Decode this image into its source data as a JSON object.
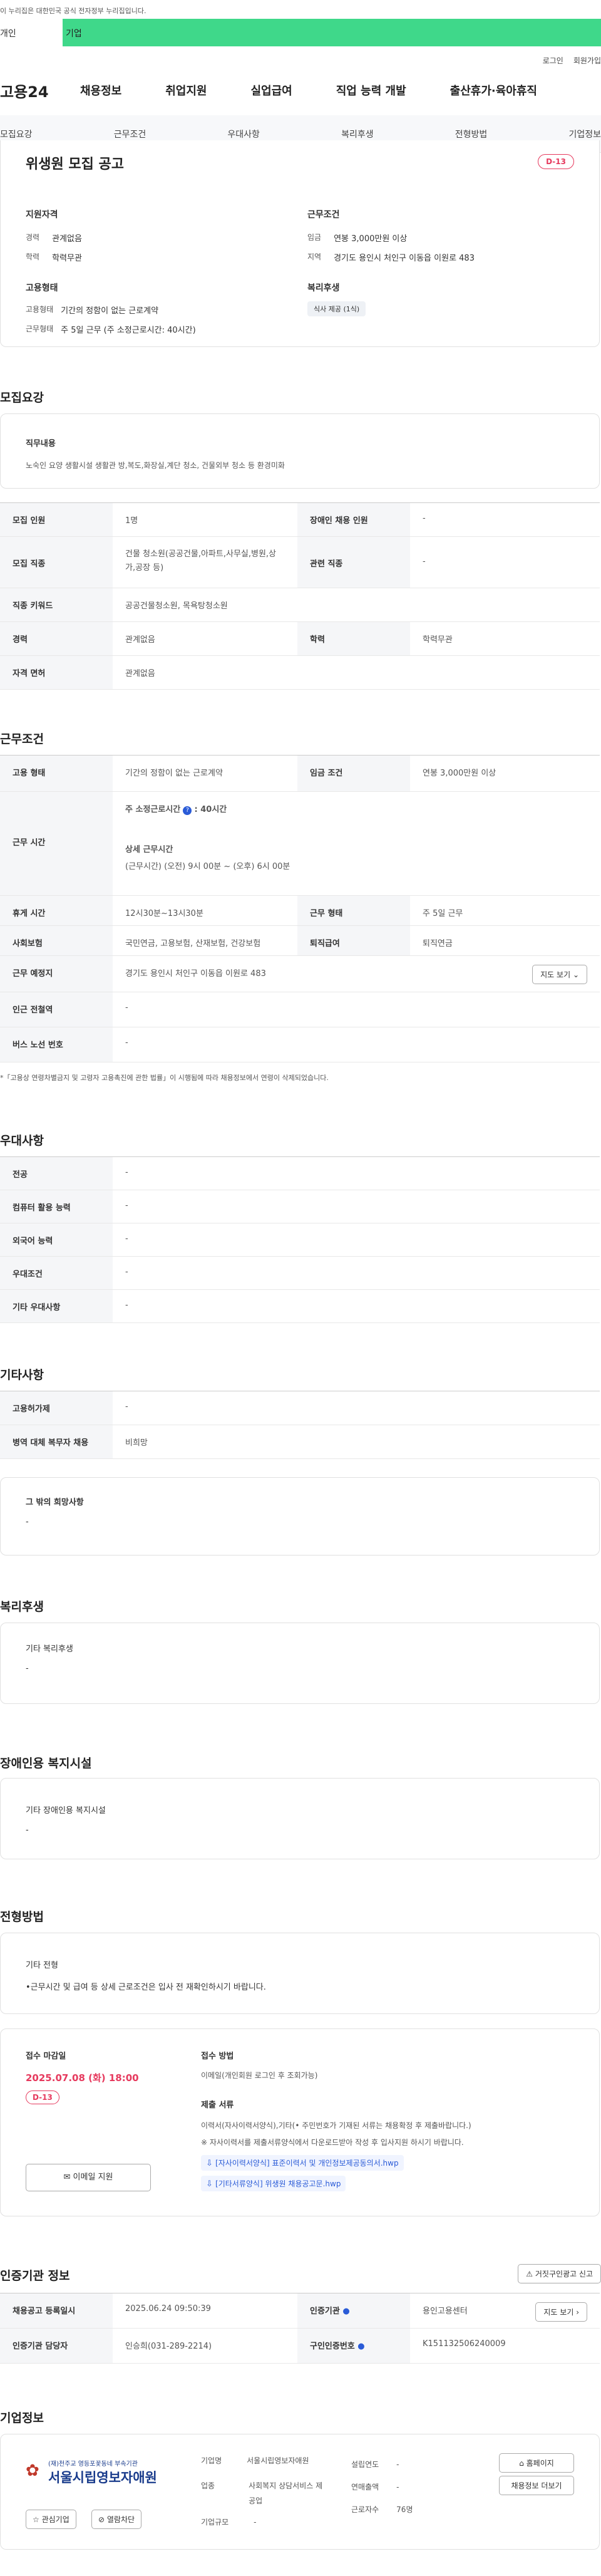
{
  "gov_bar": "이 누리집은 대한민국 공식 전자정부 누리집입니다.",
  "top_tabs": [
    "개인",
    "기업"
  ],
  "util": [
    "로그인",
    "회원가입"
  ],
  "gnb": {
    "logo": "고용24",
    "menus": [
      "채용정보",
      "취업지원",
      "실업급여",
      "직업 능력 개발",
      "출산휴가·육아휴직"
    ]
  },
  "lnb": [
    "모집요강",
    "근무조건",
    "우대사항",
    "복리후생",
    "전형방법",
    "기업정보"
  ],
  "job": {
    "title": "위생원 모집 공고",
    "dday": "D-13",
    "qual": {
      "title": "지원자격",
      "career_label": "경력",
      "career": "관계없음",
      "edu_label": "학력",
      "edu": "학력무관"
    },
    "cond": {
      "title": "근무조건",
      "pay_label": "임금",
      "pay": "연봉 3,000만원 이상",
      "region_label": "지역",
      "region": "경기도 용인시 처인구 이동읍 이원로 483"
    },
    "emp": {
      "title": "고용형태",
      "type_label": "고용형태",
      "type": "기간의 정함이 없는 근로계약",
      "work_label": "근무형태",
      "work": "주 5일 근무 (주 소정근로시간: 40시간)"
    },
    "welfare": {
      "title": "복리후생",
      "badge": "식사 제공 (1식)"
    }
  },
  "recruit": {
    "title": "모집요강",
    "duty_label": "직무내용",
    "duty": "노숙인 요양 생활시설 생활관 방,복도,화장실,계단 청소, 건물외부 청소 등 환경미화",
    "rows": [
      {
        "l1": "모집 인원",
        "v1": "1명",
        "l2": "장애인 채용 인원",
        "v2": "-"
      },
      {
        "l1": "모집 직종",
        "v1": "건물 청소원(공공건물,아파트,사무실,병원,상가,공장 등)",
        "l2": "관련 직종",
        "v2": "-"
      },
      {
        "l1": "직종 키워드",
        "v1": "공공건물청소원, 목욕탕청소원"
      },
      {
        "l1": "경력",
        "v1": "관계없음",
        "l2": "학력",
        "v2": "학력무관"
      },
      {
        "l1": "자격 면허",
        "v1": "관계없음"
      }
    ]
  },
  "work": {
    "title": "근무조건",
    "emp_label": "고용 형태",
    "emp": "기간의 정함이 없는 근로계약",
    "wage_label": "임금 조건",
    "wage": "연봉 3,000만원 이상",
    "time_label": "근무 시간",
    "weekly": "주 소정근로시간",
    "weekly_val": ": 40시간",
    "detail_title": "상세 근무시간",
    "detail": "(근무시간) (오전) 9시 00분 ~ (오후) 6시 00분",
    "rest_label": "휴게 시간",
    "rest": "12시30분~13시30분",
    "shape_label": "근무 형태",
    "shape": "주 5일 근무",
    "ins_label": "사회보험",
    "ins": "국민연금, 고용보험, 산재보험, 건강보험",
    "retire_label": "퇴직급여",
    "retire": "퇴직연금",
    "place_label": "근무 예정지",
    "place": "경기도 용인시 처인구 이동읍 이원로 483",
    "map_btn": "지도 보기",
    "sub_label": "인근 전철역",
    "sub": "-",
    "bus_label": "버스 노선 번호",
    "bus": "-",
    "note": "*「고용상 연령차별금지 및 고령자 고용촉진에 관한 법률」이 시행됨에 따라 채용정보에서 연령이 삭제되었습니다."
  },
  "pref": {
    "title": "우대사항",
    "rows": [
      [
        "전공",
        "-"
      ],
      [
        "컴퓨터 활용 능력",
        "-"
      ],
      [
        "외국어 능력",
        "-"
      ],
      [
        "우대조건",
        "-"
      ],
      [
        "기타 우대사항",
        "-"
      ]
    ]
  },
  "etc": {
    "title": "기타사항",
    "rows": [
      [
        "고용허가제",
        "-"
      ],
      [
        "병역 대체 복무자 채용",
        "비희망"
      ]
    ],
    "other_label": "그 밖의 희망사항",
    "other": "-"
  },
  "benefit": {
    "title": "복리후생",
    "label": "기타 복리후생",
    "value": "-"
  },
  "disab": {
    "title": "장애인용 복지시설",
    "label": "기타 장애인용 복지시설",
    "value": "-"
  },
  "select": {
    "title": "전형방법",
    "label": "기타 전형",
    "value": "•근무시간 및 급여 등 상세 근로조건은 입사 전 재확인하시기 바랍니다."
  },
  "apply": {
    "deadline_label": "접수 마감일",
    "deadline": "2025.07.08 (화) 18:00",
    "dday": "D-13",
    "email_btn": "이메일 지원",
    "method_label": "접수 방법",
    "method": "이메일(개인회원 로그인 후 조회가능)",
    "docs_label": "제출 서류",
    "docs": "이력서(자사이력서양식),기타(• 주민번호가 기재된 서류는 채용확정 후 제출바랍니다.)",
    "docs_note": "※ 자사이력서를 제출서류양식에서 다운로드받아 작성 후 입사지원 하시기 바랍니다.",
    "file1": "[자사이력서양식] 표준이력서 및 개인정보제공동의서.hwp",
    "file2": "[기타서류양식] 위생원 채용공고문.hwp"
  },
  "cert": {
    "title": "인증기관 정보",
    "report_btn": "거짓구인광고 신고",
    "reg_label": "채용공고 등록일시",
    "reg": "2025.06.24 09:50:39",
    "org_label": "인증기관",
    "org": "용인고용센터",
    "map_btn": "지도 보기",
    "mgr_label": "인증기관 담당자",
    "mgr": "인승희(031-289-2214)",
    "no_label": "구인인증번호",
    "no": "K151132506240009"
  },
  "company": {
    "title": "기업정보",
    "logo_small": "(재)천주교 영등포꽃동네 부속기관",
    "logo_main": "서울시립영보자애원",
    "fav": "관심기업",
    "block": "열람차단",
    "name_label": "기업명",
    "name": "서울시립영보자애원",
    "year_label": "설립연도",
    "year": "-",
    "home_btn": "홈페이지",
    "ind_label": "업종",
    "ind": "사회복지 상담서비스 제공업",
    "sales_label": "연매출액",
    "sales": "-",
    "list_btn": "채용정보 더보기",
    "emp_label": "근로자수",
    "emp": "76명",
    "scale_label": "기업규모",
    "scale": "-"
  }
}
